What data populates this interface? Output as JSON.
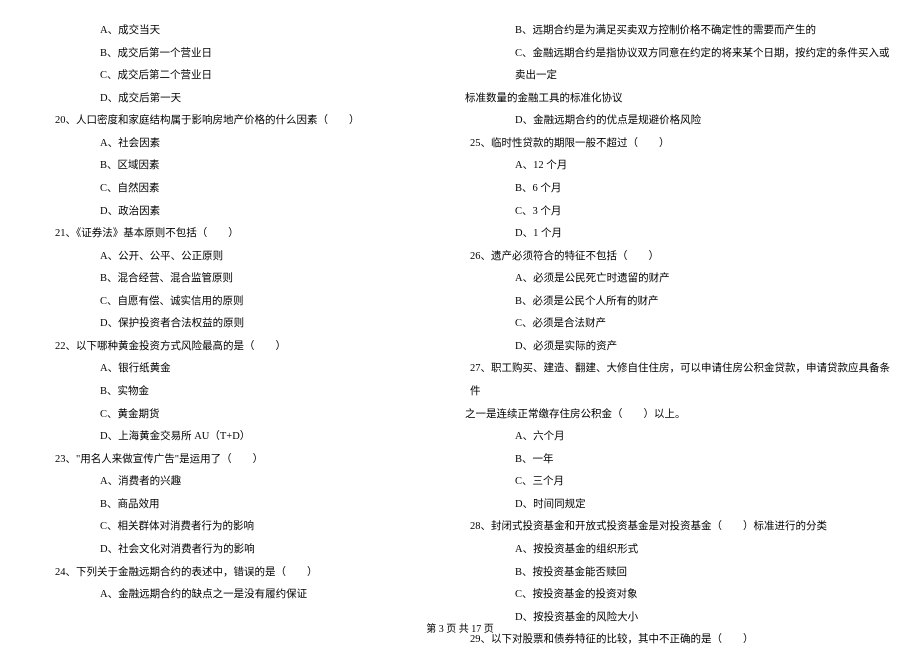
{
  "left_column": {
    "q19_prefix_options": [
      "A、成交当天",
      "B、成交后第一个营业日",
      "C、成交后第二个营业日",
      "D、成交后第一天"
    ],
    "q20": {
      "text": "20、人口密度和家庭结构属于影响房地产价格的什么因素（　　）",
      "options": [
        "A、社会因素",
        "B、区域因素",
        "C、自然因素",
        "D、政治因素"
      ]
    },
    "q21": {
      "text": "21、《证券法》基本原则不包括（　　）",
      "options": [
        "A、公开、公平、公正原则",
        "B、混合经营、混合监管原则",
        "C、自愿有偿、诚实信用的原则",
        "D、保护投资者合法权益的原则"
      ]
    },
    "q22": {
      "text": "22、以下哪种黄金投资方式风险最高的是（　　）",
      "options": [
        "A、银行纸黄金",
        "B、实物金",
        "C、黄金期货",
        "D、上海黄金交易所 AU（T+D）"
      ]
    },
    "q23": {
      "text": "23、\"用名人来做宣传广告\"是运用了（　　）",
      "options": [
        "A、消费者的兴趣",
        "B、商品效用",
        "C、相关群体对消费者行为的影响",
        "D、社会文化对消费者行为的影响"
      ]
    },
    "q24": {
      "text": "24、下列关于金融远期合约的表述中，错误的是（　　）",
      "options": [
        "A、金融远期合约的缺点之一是没有履约保证"
      ]
    }
  },
  "right_column": {
    "q24_remaining_options": [
      "B、远期合约是为满足买卖双方控制价格不确定性的需要而产生的",
      "C、金融远期合约是指协议双方同意在约定的将来某个日期，按约定的条件买入或卖出一定"
    ],
    "q24_continuation": "标准数量的金融工具的标准化协议",
    "q24_option_d": "D、金融远期合约的优点是规避价格风险",
    "q25": {
      "text": "25、临时性贷款的期限一般不超过（　　）",
      "options": [
        "A、12 个月",
        "B、6 个月",
        "C、3 个月",
        "D、1 个月"
      ]
    },
    "q26": {
      "text": "26、遗产必须符合的特征不包括（　　）",
      "options": [
        "A、必须是公民死亡时遗留的财产",
        "B、必须是公民个人所有的财产",
        "C、必须是合法财产",
        "D、必须是实际的资产"
      ]
    },
    "q27": {
      "text": "27、职工购买、建造、翻建、大修自住住房，可以申请住房公积金贷款，申请贷款应具备条件",
      "continuation": "之一是连续正常缴存住房公积金（　　）以上。",
      "options": [
        "A、六个月",
        "B、一年",
        "C、三个月",
        "D、时间同规定"
      ]
    },
    "q28": {
      "text": "28、封闭式投资基金和开放式投资基金是对投资基金（　　）标准进行的分类",
      "options": [
        "A、按投资基金的组织形式",
        "B、按投资基金能否赎回",
        "C、按投资基金的投资对象",
        "D、按投资基金的风险大小"
      ]
    },
    "q29": {
      "text": "29、以下对股票和债券特征的比较，其中不正确的是（　　）"
    }
  },
  "footer": "第 3 页 共 17 页"
}
